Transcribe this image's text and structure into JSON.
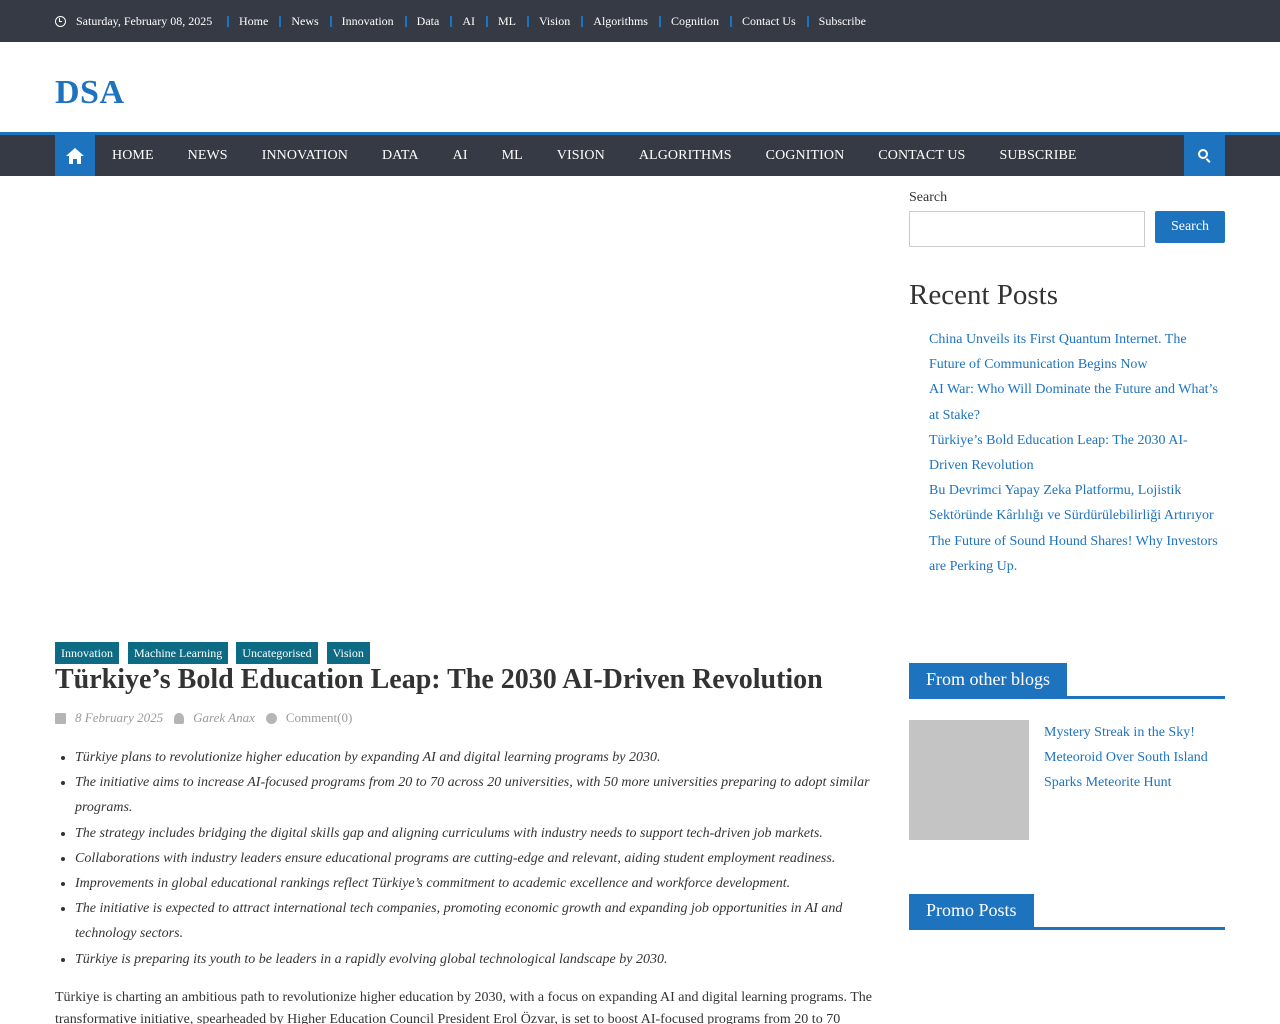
{
  "topbar": {
    "date": "Saturday, February 08, 2025",
    "links": [
      "Home",
      "News",
      "Innovation",
      "Data",
      "AI",
      "ML",
      "Vision",
      "Algorithms",
      "Cognition",
      "Contact Us",
      "Subscribe"
    ]
  },
  "site": {
    "logo": "DSA"
  },
  "mainnav": {
    "items": [
      "Home",
      "News",
      "Innovation",
      "Data",
      "AI",
      "ML",
      "Vision",
      "Algorithms",
      "Cognition",
      "Contact Us",
      "Subscribe"
    ]
  },
  "sidebar": {
    "search_label": "Search",
    "search_button": "Search",
    "recent_title": "Recent Posts",
    "recent_posts": [
      "China Unveils its First Quantum Internet. The Future of Communication Begins Now",
      "AI War: Who Will Dominate the Future and What’s at Stake?",
      "Türkiye’s Bold Education Leap: The 2030 AI-Driven Revolution",
      "Bu Devrimci Yapay Zeka Platformu, Lojistik Sektöründe Kârlılığı ve Sürdürülebilirliği Artırıyor",
      "The Future of Sound Hound Shares! Why Investors are Perking Up."
    ],
    "other_blogs_title": "From other blogs",
    "other_blog_post": "Mystery Streak in the Sky! Meteoroid Over South Island Sparks Meteorite Hunt",
    "promo_title": "Promo Posts"
  },
  "article": {
    "categories": [
      "Innovation",
      "Machine Learning",
      "Uncategorised",
      "Vision"
    ],
    "title": "Türkiye’s Bold Education Leap: The 2030 AI-Driven Revolution",
    "date": "8 February 2025",
    "author": "Garek Anax",
    "comments": "Comment(0)",
    "bullets": [
      "Türkiye plans to revolutionize higher education by expanding AI and digital learning programs by 2030.",
      "The initiative aims to increase AI-focused programs from 20 to 70 across 20 universities, with 50 more universities preparing to adopt similar programs.",
      "The strategy includes bridging the digital skills gap and aligning curriculums with industry needs to support tech-driven job markets.",
      "Collaborations with industry leaders ensure educational programs are cutting-edge and relevant, aiding student employment readiness.",
      "Improvements in global educational rankings reflect Türkiye’s commitment to academic excellence and workforce development.",
      "The initiative is expected to attract international tech companies, promoting economic growth and expanding job opportunities in AI and technology sectors.",
      "Türkiye is preparing its youth to be leaders in a rapidly evolving global technological landscape by 2030."
    ],
    "body": "Türkiye is charting an ambitious path to revolutionize higher education by 2030, with a focus on expanding AI and digital learning programs. The transformative initiative, spearheaded by Higher Education Council President Erol Özvar, is set to boost AI-focused programs from 20 to 70"
  },
  "colors": {
    "accent": "#1e73be",
    "topbar": "#363a44",
    "category": "#0e6b84"
  },
  "icons": [
    "clock-icon",
    "home-icon",
    "search-icon",
    "calendar-icon",
    "user-icon",
    "comment-icon"
  ]
}
